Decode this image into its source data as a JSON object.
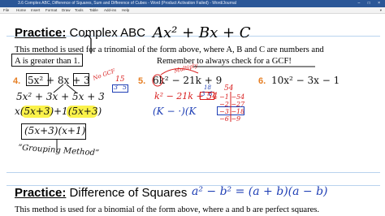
{
  "window": {
    "title": "3.6 Complex ABC, Difference of Squares, Sum and Difference of Cubes - Word (Product Activation Failed) - Word/Journal",
    "menu": [
      "File",
      "Home",
      "Insert",
      "Format",
      "Draw",
      "Tools",
      "Table",
      "Add-ins",
      "Help"
    ]
  },
  "section1": {
    "keyword": "Practice:",
    "title": "Complex ABC",
    "formula": "Ax² + Bx + C",
    "para_line1": "This method is used for a trinomial of the form above, where A, B and C are numbers and",
    "para_line2_a": "A is greater than 1.",
    "para_line2_b": "Remember to always check for a GCF!"
  },
  "problems": [
    {
      "number": "4.",
      "expr": "5x² + 8x + 3"
    },
    {
      "number": "5.",
      "expr": "6k² − 21k + 9"
    },
    {
      "number": "6.",
      "expr": "10x² − 3x − 1"
    }
  ],
  "handwriting": {
    "no_gcf": "No GCF",
    "ac_top": "15",
    "ac_left": "3",
    "ac_right": "5",
    "step1": "5x² + 3x + 5x + 3",
    "step2_a": "x(5x+3)",
    "step2_b": "+1(5x+3)",
    "answer": "(5x+3)(x+1)",
    "grouping": "“Grouping Method”",
    "gcf_label": "3(",
    "multiply": "Multiply",
    "p5_line": "k² − 21k + 54",
    "p5_factors": "(K − ·)(K",
    "t54": "54",
    "t_row1": "−1  −54",
    "t_row2": "−2  −27",
    "t_row3": "−3  −18",
    "t_row4": "−6  −9",
    "mini_top": "18",
    "mini_left": "3",
    "mini_right": "6"
  },
  "section2": {
    "keyword": "Practice:",
    "title": "Difference of Squares",
    "formula": "a² − b² = (a + b)(a − b)",
    "partial": "This method is used for a binomial of the form above, where a and b are perfect squares."
  }
}
